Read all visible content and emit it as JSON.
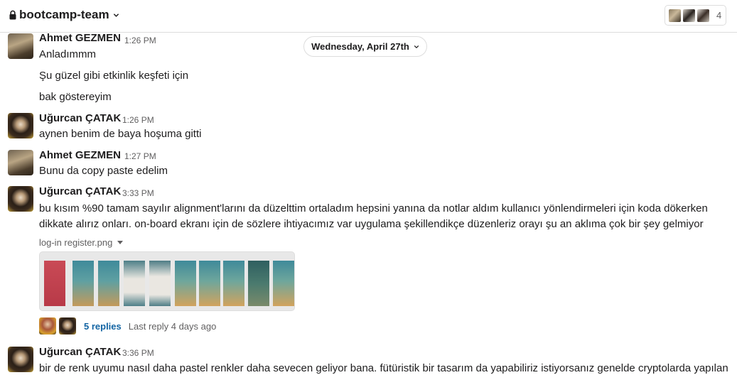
{
  "header": {
    "channel_name": "bootcamp-team",
    "member_count": "4"
  },
  "date_divider": "Wednesday, April 27th",
  "messages": [
    {
      "author": "Ahmet GEZMEN",
      "time": "1:26 PM",
      "lines": [
        "Anladımmm",
        "Şu güzel gibi etkinlik keşfeti için",
        "bak göstereyim"
      ]
    },
    {
      "author": "Uğurcan ÇATAK",
      "time": "1:26 PM",
      "lines": [
        "aynen benim de baya hoşuma gitti"
      ]
    },
    {
      "author": "Ahmet GEZMEN",
      "time": "1:27 PM",
      "lines": [
        "Bunu da copy paste edelim"
      ]
    },
    {
      "author": "Uğurcan ÇATAK",
      "time": "3:33 PM",
      "lines": [
        "bu kısım %90 tamam sayılır alignment'larını da düzelttim ortaladım hepsini yanına da notlar aldım kullanıcı yönlendirmeleri için koda dökerken",
        "dikkate alırız onları. on-board ekranı için de sözlere ihtiyacımız var uygulama şekillendikçe düzenleriz orayı şu an aklıma çok bir şey gelmiyor"
      ],
      "attachment": {
        "file_name": "log-in register.png"
      },
      "thread": {
        "replies": "5 replies",
        "last_reply": "Last reply 4 days ago"
      }
    },
    {
      "author": "Uğurcan ÇATAK",
      "time": "3:36 PM",
      "lines": [
        "bir de renk uyumu nasıl daha pastel renkler daha sevecen geliyor bana. fütüristik bir tasarım da yapabiliriz istiyorsanız genelde cryptolarda yapılan"
      ]
    }
  ],
  "icons": {
    "lock": "lock-icon",
    "channel_menu": "chevron-down-icon",
    "date_menu": "chevron-down-icon",
    "file_menu": "caret-down-icon"
  },
  "colors": {
    "link": "#1264a3",
    "text": "#1d1c1d",
    "muted": "#616061",
    "border": "#dddddd"
  }
}
